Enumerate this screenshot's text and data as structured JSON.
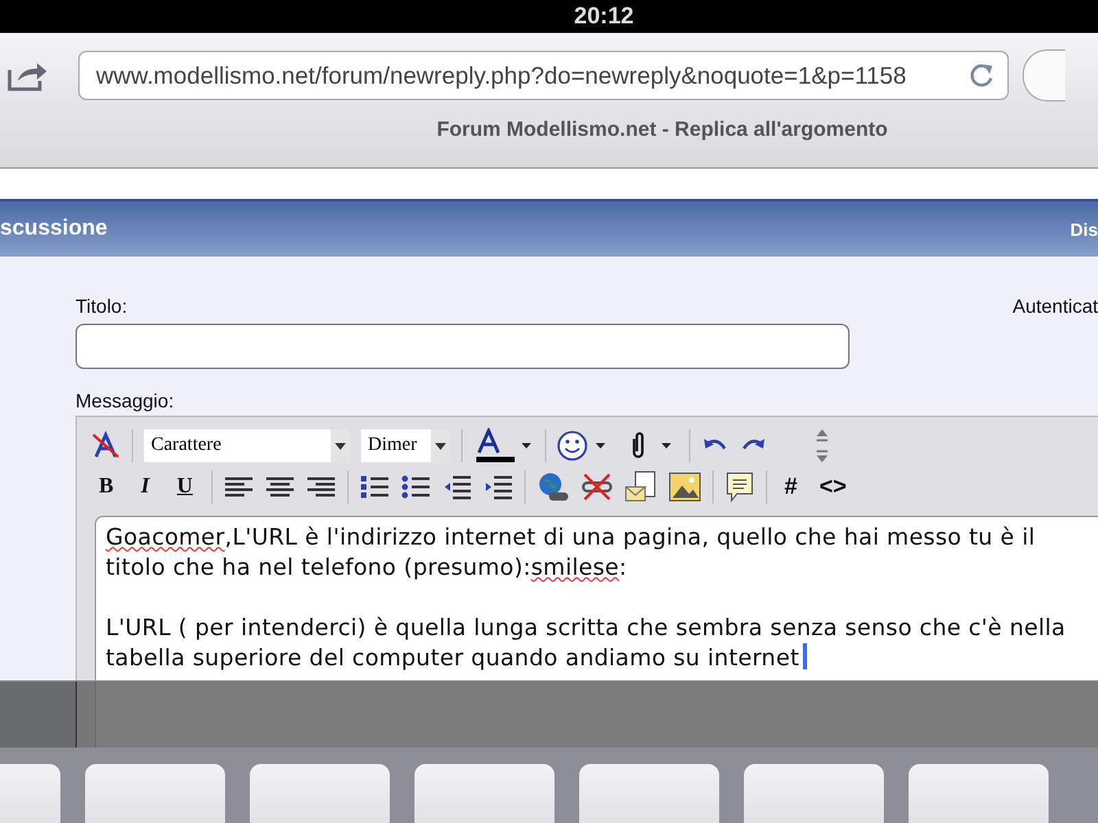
{
  "status_bar": {
    "time": "20:12"
  },
  "browser": {
    "url": "www.modellismo.net/forum/newreply.php?do=newreply&noquote=1&p=1158",
    "page_title": "Forum Modellismo.net - Replica all'argomento"
  },
  "header": {
    "left": "scussione",
    "right": "Dis"
  },
  "form": {
    "title_label": "Titolo:",
    "side_label": "Autenticat",
    "message_label": "Messaggio:"
  },
  "editor": {
    "font_select": "Carattere",
    "size_select": "Dimer",
    "format_buttons": [
      "B",
      "I",
      "U"
    ],
    "code_buttons": [
      "#",
      "<>"
    ],
    "paragraphs": [
      [
        {
          "text": "Goacomer",
          "misspelled": true
        },
        {
          "text": ",L'URL è l'indirizzo internet di una pagina, quello che hai messo tu è il titolo che ha nel telefono (presumo):",
          "misspelled": false
        },
        {
          "text": "smilese",
          "misspelled": true
        },
        {
          "text": ":",
          "misspelled": false
        }
      ],
      [
        {
          "text": "L'URL ( per intenderci) è quella lunga scritta che sembra senza senso che c'è nella tabella superiore del computer quando andiamo su internet",
          "misspelled": false
        }
      ]
    ]
  }
}
